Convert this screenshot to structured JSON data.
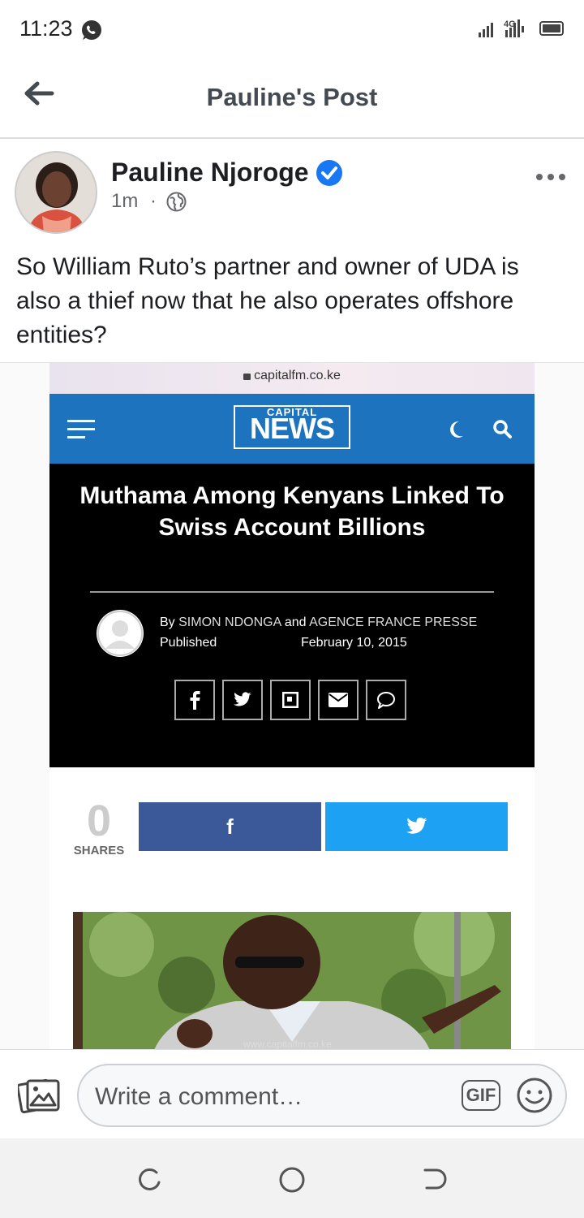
{
  "status_bar": {
    "time": "11:23",
    "network": "4G"
  },
  "header": {
    "title": "Pauline's Post"
  },
  "post": {
    "author": "Pauline Njoroge",
    "time": "1m",
    "separator": "·",
    "text": "So William Ruto’s partner and owner of UDA is also a thief now that he also operates offshore entities?"
  },
  "embed": {
    "url": "capitalfm.co.ke",
    "logo_top": "CAPITAL",
    "logo_main": "NEWS",
    "headline": "Muthama Among Kenyans Linked To Swiss Account Billions",
    "byline_by": "By",
    "byline_author1": "SIMON NDONGA",
    "byline_and": "and",
    "byline_author2": "AGENCE FRANCE PRESSE",
    "published_label": "Published",
    "date": "February 10, 2015",
    "share_count": "0",
    "shares_label": "SHARES",
    "fb_label": "f",
    "watermark": "www.capitalfm.co.ke"
  },
  "comment": {
    "placeholder": "Write a comment…",
    "gif_label": "GIF"
  },
  "colors": {
    "brand_blue": "#1e73be",
    "verified": "#1877f2",
    "facebook": "#3b5998",
    "twitter": "#1da1f2"
  }
}
